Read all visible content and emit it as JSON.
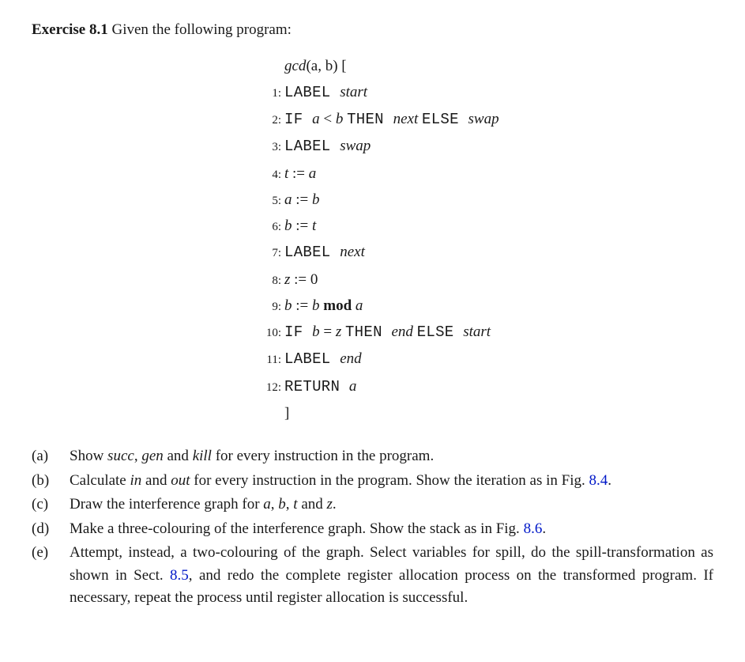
{
  "intro": {
    "exercise_label": "Exercise 8.1",
    "lead": "  Given the following program:"
  },
  "code": {
    "header": {
      "fn": "gcd",
      "args": "(a, b)",
      "open": " ["
    },
    "lines": [
      {
        "n": "1:",
        "parts": [
          {
            "t": "kw",
            "v": "LABEL "
          },
          {
            "t": "it",
            "v": "start"
          }
        ]
      },
      {
        "n": "2:",
        "parts": [
          {
            "t": "kw",
            "v": "IF "
          },
          {
            "t": "it",
            "v": "a "
          },
          {
            "t": "rm",
            "v": "< "
          },
          {
            "t": "it",
            "v": "b "
          },
          {
            "t": "kw",
            "v": "THEN "
          },
          {
            "t": "it",
            "v": "next "
          },
          {
            "t": "kw",
            "v": "ELSE "
          },
          {
            "t": "it",
            "v": "swap"
          }
        ]
      },
      {
        "n": "3:",
        "parts": [
          {
            "t": "kw",
            "v": "LABEL "
          },
          {
            "t": "it",
            "v": "swap"
          }
        ]
      },
      {
        "n": "4:",
        "parts": [
          {
            "t": "it",
            "v": "t "
          },
          {
            "t": "rm",
            "v": ":= "
          },
          {
            "t": "it",
            "v": "a"
          }
        ]
      },
      {
        "n": "5:",
        "parts": [
          {
            "t": "it",
            "v": "a "
          },
          {
            "t": "rm",
            "v": ":= "
          },
          {
            "t": "it",
            "v": "b"
          }
        ]
      },
      {
        "n": "6:",
        "parts": [
          {
            "t": "it",
            "v": "b "
          },
          {
            "t": "rm",
            "v": ":= "
          },
          {
            "t": "it",
            "v": "t"
          }
        ]
      },
      {
        "n": "7:",
        "parts": [
          {
            "t": "kw",
            "v": "LABEL "
          },
          {
            "t": "it",
            "v": "next"
          }
        ]
      },
      {
        "n": "8:",
        "parts": [
          {
            "t": "it",
            "v": "z "
          },
          {
            "t": "rm",
            "v": ":= 0"
          }
        ]
      },
      {
        "n": "9:",
        "parts": [
          {
            "t": "it",
            "v": "b "
          },
          {
            "t": "rm",
            "v": ":= "
          },
          {
            "t": "it",
            "v": "b "
          },
          {
            "t": "bd",
            "v": "mod "
          },
          {
            "t": "it",
            "v": "a"
          }
        ]
      },
      {
        "n": "10:",
        "parts": [
          {
            "t": "kw",
            "v": "IF "
          },
          {
            "t": "it",
            "v": "b "
          },
          {
            "t": "rm",
            "v": "= "
          },
          {
            "t": "it",
            "v": "z "
          },
          {
            "t": "kw",
            "v": "THEN "
          },
          {
            "t": "it",
            "v": "end "
          },
          {
            "t": "kw",
            "v": "ELSE "
          },
          {
            "t": "it",
            "v": "start"
          }
        ]
      },
      {
        "n": "11:",
        "parts": [
          {
            "t": "kw",
            "v": "LABEL "
          },
          {
            "t": "it",
            "v": "end"
          }
        ]
      },
      {
        "n": "12:",
        "parts": [
          {
            "t": "kw",
            "v": "RETURN "
          },
          {
            "t": "it",
            "v": "a"
          }
        ]
      }
    ],
    "footer": "]"
  },
  "questions": [
    {
      "label": "(a)",
      "runs": [
        {
          "v": "Show "
        },
        {
          "it": true,
          "v": "succ"
        },
        {
          "v": ", "
        },
        {
          "it": true,
          "v": "gen"
        },
        {
          "v": " and "
        },
        {
          "it": true,
          "v": "kill"
        },
        {
          "v": " for every instruction in the program."
        }
      ]
    },
    {
      "label": "(b)",
      "runs": [
        {
          "v": "Calculate "
        },
        {
          "it": true,
          "v": "in"
        },
        {
          "v": " and "
        },
        {
          "it": true,
          "v": "out"
        },
        {
          "v": " for every instruction in the program. Show the iteration as in Fig. "
        },
        {
          "link": true,
          "v": "8.4"
        },
        {
          "v": "."
        }
      ]
    },
    {
      "label": "(c)",
      "runs": [
        {
          "v": "Draw the interference graph for "
        },
        {
          "it": true,
          "v": "a"
        },
        {
          "v": ", "
        },
        {
          "it": true,
          "v": "b"
        },
        {
          "v": ", "
        },
        {
          "it": true,
          "v": "t"
        },
        {
          "v": " and "
        },
        {
          "it": true,
          "v": "z"
        },
        {
          "v": "."
        }
      ]
    },
    {
      "label": "(d)",
      "runs": [
        {
          "v": "Make a three-colouring of the interference graph. Show the stack as in Fig. "
        },
        {
          "link": true,
          "v": "8.6"
        },
        {
          "v": "."
        }
      ]
    },
    {
      "label": "(e)",
      "runs": [
        {
          "v": "Attempt, instead, a two-colouring of the graph. Select variables for spill, do the spill-transformation as shown in Sect. "
        },
        {
          "link": true,
          "v": "8.5"
        },
        {
          "v": ", and redo the complete register allocation process on the transformed program. If necessary, repeat the process until register allocation is successful."
        }
      ]
    }
  ]
}
